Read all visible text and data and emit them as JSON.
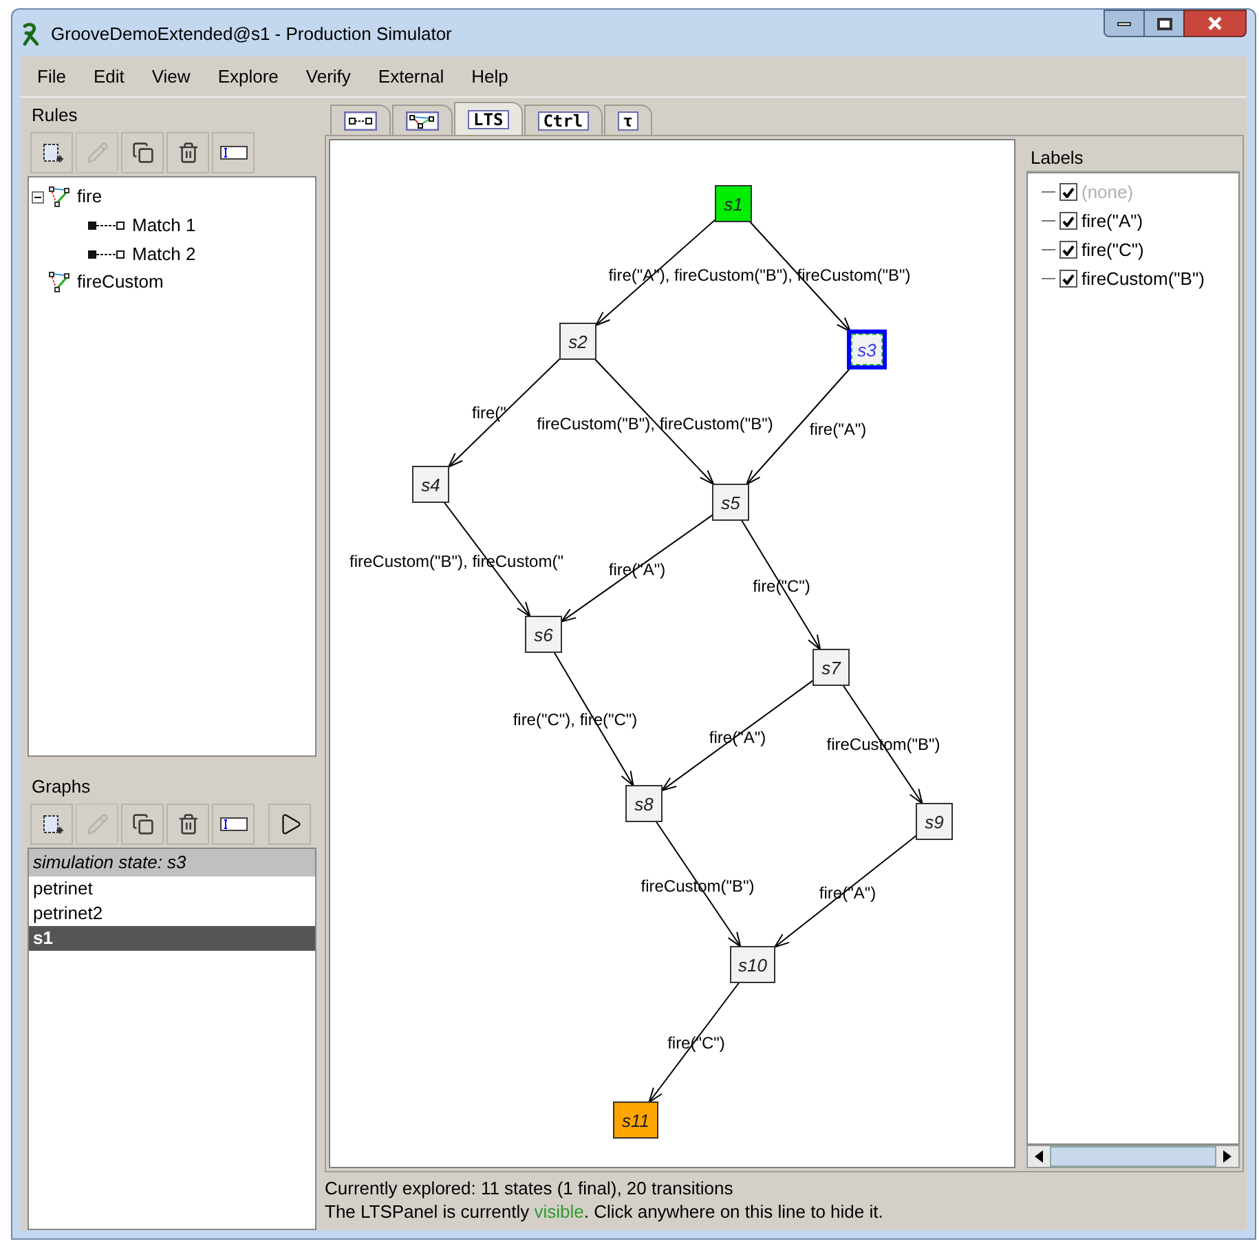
{
  "window": {
    "title": "GrooveDemoExtended@s1 - Production Simulator"
  },
  "menu": [
    "File",
    "Edit",
    "View",
    "Explore",
    "Verify",
    "External",
    "Help"
  ],
  "rules": {
    "title": "Rules",
    "toolbar": [
      {
        "kind": "new",
        "disabled": false
      },
      {
        "kind": "edit",
        "disabled": true
      },
      {
        "kind": "copy",
        "disabled": false
      },
      {
        "kind": "delete",
        "disabled": false
      },
      {
        "kind": "rename",
        "disabled": false
      }
    ],
    "tree": [
      {
        "label": "fire",
        "expanded": true,
        "children": [
          {
            "label": "Match 1"
          },
          {
            "label": "Match 2"
          }
        ]
      },
      {
        "label": "fireCustom"
      }
    ]
  },
  "graphs": {
    "title": "Graphs",
    "toolbar": [
      {
        "kind": "new",
        "disabled": false
      },
      {
        "kind": "edit",
        "disabled": true
      },
      {
        "kind": "copy",
        "disabled": false
      },
      {
        "kind": "delete",
        "disabled": false
      },
      {
        "kind": "rename",
        "disabled": false
      },
      {
        "kind": "play",
        "disabled": false
      }
    ],
    "items": [
      {
        "kind": "header",
        "label": "simulation state: s3",
        "selected": false
      },
      {
        "kind": "graph",
        "label": "petrinet",
        "selected": false
      },
      {
        "kind": "graph",
        "label": "petrinet2",
        "selected": false
      },
      {
        "kind": "graph",
        "label": "s1",
        "selected": true
      }
    ]
  },
  "tabs": [
    {
      "kind": "graph",
      "selected": false
    },
    {
      "kind": "rule",
      "selected": false
    },
    {
      "kind": "text",
      "label": "LTS",
      "selected": true
    },
    {
      "kind": "text",
      "label": "Ctrl",
      "selected": false
    },
    {
      "kind": "text",
      "label": "τ",
      "selected": false
    }
  ],
  "lts": {
    "states": [
      {
        "label": "s1",
        "kind": "start",
        "selected": false
      },
      {
        "label": "s2",
        "kind": "normal",
        "selected": false
      },
      {
        "label": "s3",
        "kind": "normal",
        "selected": true
      },
      {
        "label": "s4",
        "kind": "normal",
        "selected": false
      },
      {
        "label": "s5",
        "kind": "normal",
        "selected": false
      },
      {
        "label": "s6",
        "kind": "normal",
        "selected": false
      },
      {
        "label": "s7",
        "kind": "normal",
        "selected": false
      },
      {
        "label": "s8",
        "kind": "normal",
        "selected": false
      },
      {
        "label": "s9",
        "kind": "normal",
        "selected": false
      },
      {
        "label": "s10",
        "kind": "normal",
        "selected": false
      },
      {
        "label": "s11",
        "kind": "final",
        "selected": false
      }
    ],
    "edge_labels": [
      "fire(\"A\"), fireCustom(\"B\"), fireCustom(\"B\")",
      "fire(\"",
      "fireCustom(\"B\"), fireCustom(\"B\")",
      "fire(\"A\")",
      "fireCustom(\"B\"), fireCustom(\"",
      "fire(\"A\")",
      "fire(\"C\")",
      "fire(\"C\"), fire(\"C\")",
      "fire(\"A\")",
      "fireCustom(\"B\")",
      "fireCustom(\"B\")",
      "fire(\"A\")",
      "fire(\"C\")"
    ]
  },
  "labels": {
    "title": "Labels",
    "items": [
      {
        "label": "(none)",
        "checked": true,
        "disabled": true
      },
      {
        "label": "fire(\"A\")",
        "checked": true,
        "disabled": false
      },
      {
        "label": "fire(\"C\")",
        "checked": true,
        "disabled": false
      },
      {
        "label": "fireCustom(\"B\")",
        "checked": true,
        "disabled": false
      }
    ]
  },
  "status": {
    "line1": "Currently explored: 11 states (1 final), 20 transitions",
    "line2_before": "The LTSPanel is currently ",
    "line2_link": "visible",
    "line2_after": ". Click anywhere on this line to hide it."
  }
}
